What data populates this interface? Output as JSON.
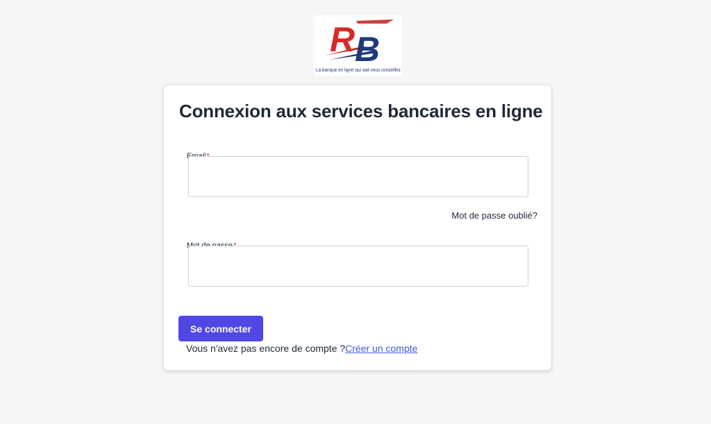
{
  "logo": {
    "letters": "RB",
    "tagline": "La banque en ligne qui sait vous conseillez",
    "colors": {
      "r": "#d62a2a",
      "b": "#1f3a7a",
      "swoosh_red": "#c21f1f",
      "swoosh_blue": "#1f3a7a"
    }
  },
  "login": {
    "title": "Connexion aux services bancaires en ligne",
    "email_label": "Email",
    "email_value": "",
    "required_mark": "*",
    "forgot_link": "Mot de passe oublié?",
    "password_label": "Mot de passe",
    "password_value": "",
    "submit_label": "Se connecter",
    "no_account_text": "Vous n'avez pas encore de compte ?",
    "create_account_link": "Créer un compte"
  },
  "colors": {
    "background": "#f6f6f6",
    "card": "#ffffff",
    "primary_button": "#5147e5",
    "link": "#3b5bdb",
    "required": "#dc2626",
    "input_border": "#c7d3e0"
  }
}
